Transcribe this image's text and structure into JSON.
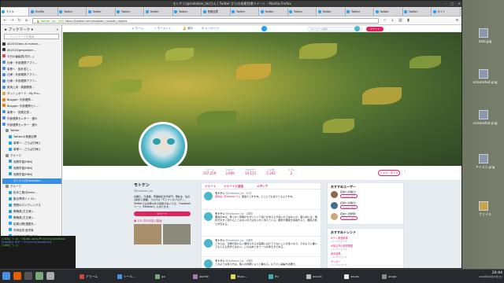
{
  "window": {
    "title": "モトケン(@motoken_tw)さん | Twitter からの長期目標ツイート - Mozilla Firefox"
  },
  "tabs": [
    {
      "label": "モトケ"
    },
    {
      "label": "Shuffle"
    },
    {
      "label": "Twitter"
    },
    {
      "label": "Twitter"
    },
    {
      "label": "Twitter"
    },
    {
      "label": "Twitter"
    },
    {
      "label": "Twitter"
    },
    {
      "label": "長期目標"
    },
    {
      "label": "Twitter"
    },
    {
      "label": "Twitter"
    },
    {
      "label": "Twitter"
    },
    {
      "label": "Twitter"
    },
    {
      "label": "Twitter"
    },
    {
      "label": "Twitter"
    },
    {
      "label": "Twitter"
    },
    {
      "label": "サイト"
    }
  ],
  "urlbar": {
    "org": "Twitter, Inc. (US)",
    "url": "https://twitter.com/motoken_tw/with_replies"
  },
  "sidebar": {
    "title": "ブックマーク",
    "search_placeholder": "ブックマークを検索",
    "items": [
      {
        "label": "AK2015/dev at master...",
        "color": "#333333"
      },
      {
        "label": "AK2015/gmgold/en...",
        "color": "#333333"
      },
      {
        "label": "今日の番組表(先行...)",
        "color": "#e0445e"
      },
      {
        "label": "仕様・外部連携アプリ...",
        "color": "#4a90e2"
      },
      {
        "label": "事業へ · 設計書と...",
        "color": "#4a90e2"
      },
      {
        "label": "仕様・外部連携アプリ...",
        "color": "#4a90e2"
      },
      {
        "label": "仕様・外部連携アプリ...",
        "color": "#4a90e2"
      },
      {
        "label": "実用上用 · 調査開発...",
        "color": "#4a90e2"
      },
      {
        "label": "ダッシュボード - My Pro...",
        "color": "#e8a33d"
      },
      {
        "label": "Blogger: 外部連携...",
        "color": "#f57d00"
      },
      {
        "label": "Blogger: 外部連携セン...",
        "color": "#f57d00"
      },
      {
        "label": "事業へ · 見積文書...",
        "color": "#4a90e2"
      },
      {
        "label": "外部連携センター · 遅れ",
        "color": "#4a90e2"
      },
      {
        "label": "外部連携センター · 遅れ",
        "color": "#4a90e2"
      },
      {
        "label": "Twitter",
        "color": "#8a8a8a"
      },
      {
        "label": "Twitterの長期目標",
        "color": "#1da1f2"
      },
      {
        "label": "事業へ - さらば方様と",
        "color": "#1da1f2"
      },
      {
        "label": "事業へ - さらば方様と",
        "color": "#1da1f2"
      },
      {
        "label": "グループ",
        "color": "#8a8a8a"
      },
      {
        "label": "深層学習(RNN)",
        "color": "#1da1f2"
      },
      {
        "label": "深層学習(RNN)",
        "color": "#1da1f2"
      },
      {
        "label": "深層学習(RNN)",
        "color": "#1da1f2"
      },
      {
        "label": "モトケン(@motoken...",
        "color": "#1da1f2"
      },
      {
        "label": "グループ",
        "color": "#8a8a8a"
      },
      {
        "label": "松本工業(@hoku...",
        "color": "#1da1f2"
      },
      {
        "label": "集合界明ツイ Dr...",
        "color": "#1da1f2"
      },
      {
        "label": "理想のロングレングス",
        "color": "#1da1f2"
      },
      {
        "label": "教職員(方丈様)...",
        "color": "#1da1f2"
      },
      {
        "label": "教職員(方丈様)...",
        "color": "#1da1f2"
      },
      {
        "label": "結果公開(連載を...",
        "color": "#1da1f2"
      },
      {
        "label": "天明自然 医学事",
        "color": "#1da1f2"
      },
      {
        "label": "天明自然(現状)方丈",
        "color": "#1da1f2"
      },
      {
        "label": "集本(集本(Ho)",
        "color": "#1da1f2"
      }
    ]
  },
  "twitter_nav": {
    "home": "ホーム",
    "moments": "モーメント",
    "notifications": "通知",
    "messages": "メッセージ",
    "search_placeholder": "キーワード検索",
    "tweet_button": "ツイート"
  },
  "stats": {
    "tweets_label": "ツイート",
    "tweets": "107,259",
    "following_label": "フォロー",
    "following": "3,699",
    "followers_label": "フォロワー",
    "followers": "19,115",
    "likes_label": "いいね",
    "likes": "5,393",
    "lists_label": "リスト",
    "lists": "2",
    "follow_button": "フォロー中です",
    "more_icon": "⋮"
  },
  "profile": {
    "name": "モトケン",
    "handle": "@motoken_tw",
    "bio": "弁護士。元検事。刑事訴訟法が専門。現在は、仙台(宮城)で開業。ブログは「モトケンのブログ」。Twitterでは法律以外の話題が多いです。 Facebookページ「Motoken」もあります。",
    "tweet_button": "ツイート",
    "media_label": "101 件の写真と動画"
  },
  "timeline": {
    "tabs": [
      "ツイート",
      "ツイートと返信",
      "メディア"
    ],
    "tweets": [
      {
        "name": "モトケン",
        "handle": "@motoken_tw · 50分",
        "reply": "返信先: @aaaaaa さん",
        "body": "間違えてますね。どこにでも出てくるんですね。"
      },
      {
        "name": "モトケン",
        "handle": "@motoken_tw · 1時間",
        "reply": "",
        "body": "国会の中は、見ておく意義が大きいという思いがある人が多いのではないか。個人的には、現状が大きく変わることはないのではないかと考えている。国家が審査を延長すると、国民の怒りが高まる。"
      },
      {
        "name": "モトケン",
        "handle": "@motoken_tw · 1時間",
        "reply": "",
        "body": "こちらは、法律が変わると期待されるが実際にはそうでないことが多いので、そのように書いてもらえる状況ではない。これはあくまで一つの考え方である。"
      },
      {
        "name": "モトケン",
        "handle": "@motoken_tw · 1時間",
        "reply": "",
        "body": "このような考え方は、個人の判断によって異なる。もう少し議論が必要だ。"
      }
    ]
  },
  "who_to_follow": {
    "title": "おすすめユーザー",
    "users": [
      {
        "name": "名前1 (弁護士)",
        "button": "フォローする"
      },
      {
        "name": "名前2 (弁護士)",
        "button": "フォローする"
      },
      {
        "name": "名前3 (法律家)",
        "button": "フォローする"
      }
    ]
  },
  "trends": {
    "title": "おすすめトレンド",
    "items": [
      {
        "tag": "#テレ東音楽祭",
        "sub": "トレンドトピック"
      },
      {
        "tag": "#岡山市の保育問題",
        "sub": "トレンドトピック"
      },
      {
        "tag": "東京競馬",
        "sub": "トレンドトピック"
      },
      {
        "tag": "サッカー",
        "sub": "トレンドトピック"
      }
    ]
  },
  "terminal": {
    "lines": [
      "[1034] % cd ~/hideo.work/Projects/panda/ws",
      "Hideo@ws-MCP:~/Projects/panda/ws$",
      "[1034] % []"
    ]
  },
  "desktop": {
    "icons": [
      {
        "label": "data.jpg"
      },
      {
        "label": "screenshot.png"
      },
      {
        "label": "screenshot.png"
      },
      {
        "label": "アイコン.png"
      },
      {
        "label": "ファイル"
      }
    ]
  },
  "taskbar": {
    "items": [
      {
        "label": "アラーム"
      },
      {
        "label": "シール..."
      },
      {
        "label": "gx"
      },
      {
        "label": "xbrfile"
      },
      {
        "label": "Mozc..."
      },
      {
        "label": "ffc"
      },
      {
        "label": "xclock"
      },
      {
        "label": "xeyes"
      },
      {
        "label": "xlogo"
      }
    ],
    "time": "20:44",
    "date": "2018年06月23日(土)"
  },
  "colors": {
    "accent": "#e0245e",
    "twitter_blue": "#1da1f2"
  }
}
